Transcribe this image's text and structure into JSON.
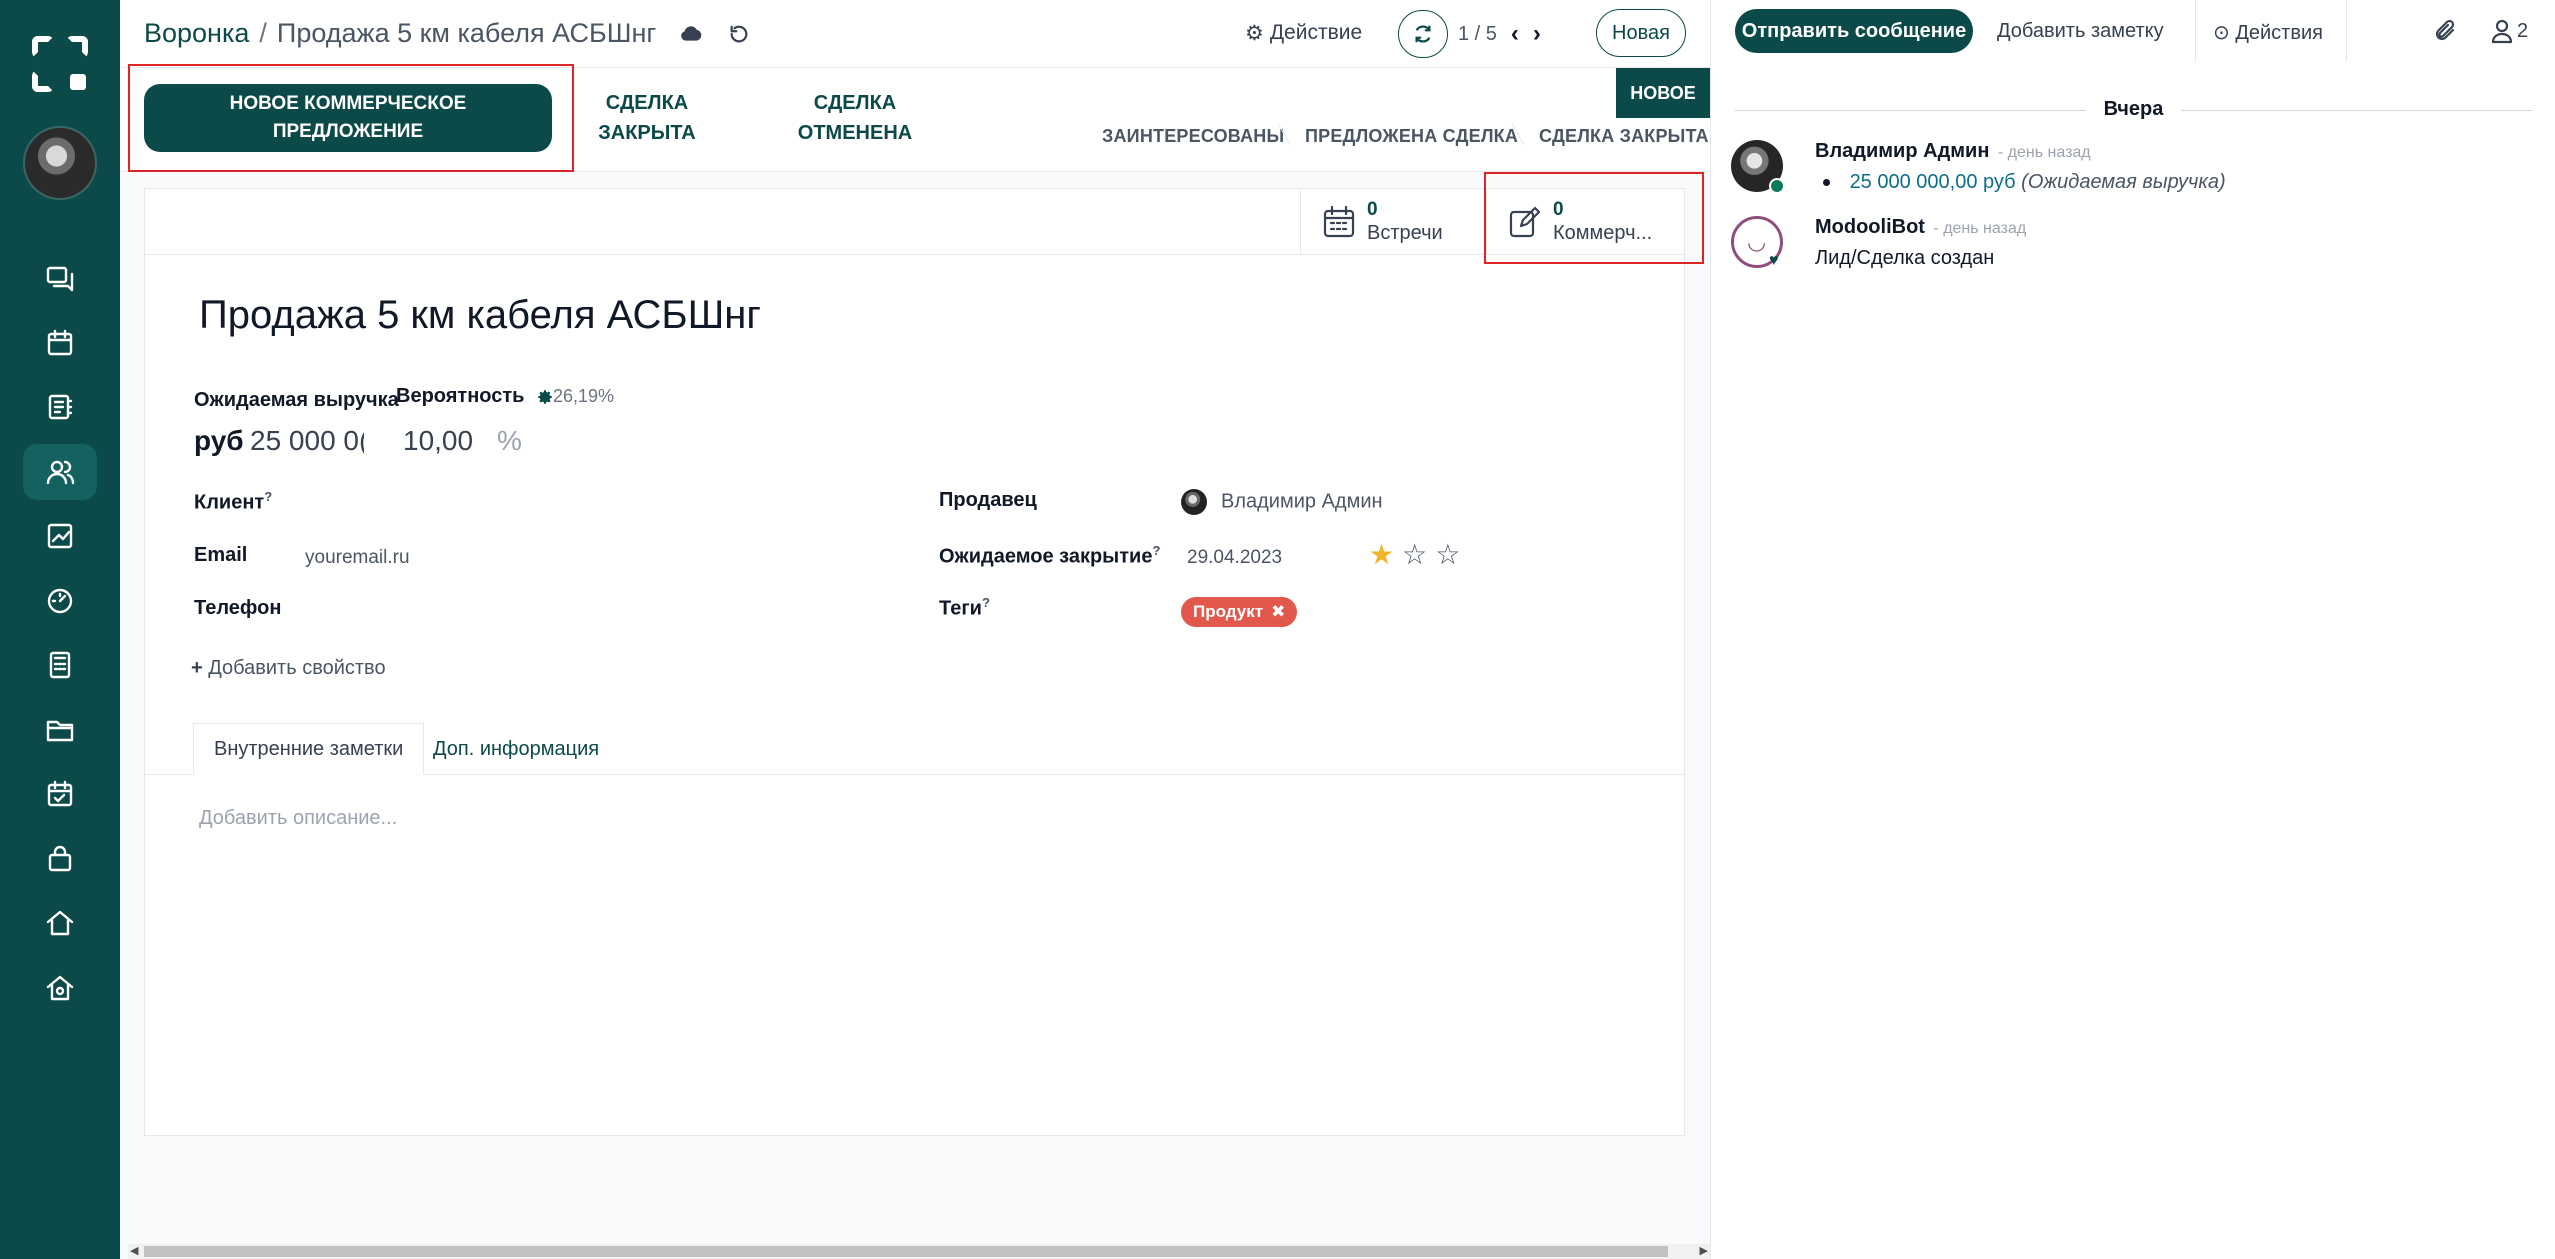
{
  "breadcrumb": {
    "parent": "Воронка",
    "separator": "/",
    "current": "Продажа 5 км кабеля АСБШнг"
  },
  "toolbar": {
    "action_label": "Действие",
    "pager": "1 / 5",
    "new_label": "Новая"
  },
  "statusbar": {
    "quote_button": "НОВОЕ КОММЕРЧЕСКОЕ ПРЕДЛОЖЕНИЕ",
    "won_button": "СДЕЛКА ЗАКРЫТА",
    "lost_button": "СДЕЛКА ОТМЕНЕНА",
    "stages": [
      "НОВОЕ",
      "ЗАИНТЕРЕСОВАНЫ",
      "ПРЕДЛОЖЕНА СДЕЛКА",
      "СДЕЛКА ЗАКРЫТА"
    ],
    "current_stage": "НОВОЕ"
  },
  "smart_buttons": [
    {
      "count": "0",
      "label": "Встречи",
      "icon": "calendar-icon"
    },
    {
      "count": "0",
      "label": "Коммерч...",
      "icon": "edit-icon"
    }
  ],
  "form": {
    "title": "Продажа 5 км кабеля АСБШнг",
    "revenue_label": "Ожидаемая выручка",
    "probability_label": "Вероятность",
    "probability_hint": "26,19%",
    "currency": "руб",
    "revenue_value": "25 000 0(",
    "probability_value": "10,00",
    "percent": "%",
    "client_label": "Клиент",
    "email_label": "Email",
    "email_value": "youremail.ru",
    "phone_label": "Телефон",
    "salesperson_label": "Продавец",
    "salesperson_value": "Владимир Админ",
    "closing_label": "Ожидаемое закрытие",
    "closing_value": "29.04.2023",
    "priority_stars": 1,
    "priority_max": 3,
    "tags_label": "Теги",
    "tag": "Продукт",
    "add_property": "Добавить свойство",
    "help_mark": "?"
  },
  "tabs": {
    "notes": "Внутренние заметки",
    "extra": "Доп. информация"
  },
  "notes": {
    "placeholder": "Добавить описание..."
  },
  "chatter": {
    "send_label": "Отправить сообщение",
    "note_label": "Добавить заметку",
    "activities_label": "Действия",
    "followers_count": "2",
    "day_label": "Вчера",
    "messages": [
      {
        "author": "Владимир Админ",
        "time": "- день назад",
        "amount": "25 000 000,00 руб",
        "field": "(Ожидаемая выручка)"
      },
      {
        "author": "ModooliBot",
        "time": "- день назад",
        "text": "Лид/Сделка создан"
      }
    ]
  },
  "colors": {
    "brand": "#0b4a48",
    "tag": "#e3584c",
    "star": "#f3b32a",
    "highlight": "#dc2626"
  }
}
